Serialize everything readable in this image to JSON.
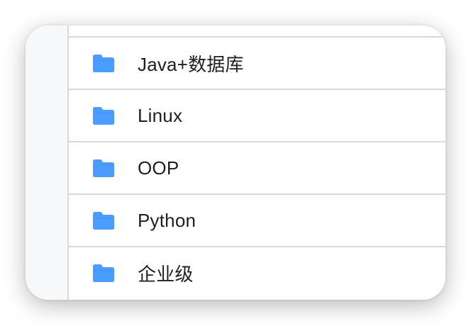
{
  "folders": [
    {
      "name": "Java+数据库",
      "icon": "folder-icon"
    },
    {
      "name": "Linux",
      "icon": "folder-icon"
    },
    {
      "name": "OOP",
      "icon": "folder-icon"
    },
    {
      "name": "Python",
      "icon": "folder-icon"
    },
    {
      "name": "企业级",
      "icon": "folder-icon"
    }
  ],
  "colors": {
    "folder_icon": "#4a9cff",
    "separator": "#d6d9df",
    "text": "#1f1f24",
    "sidebar_bg": "#f7f8fa"
  }
}
